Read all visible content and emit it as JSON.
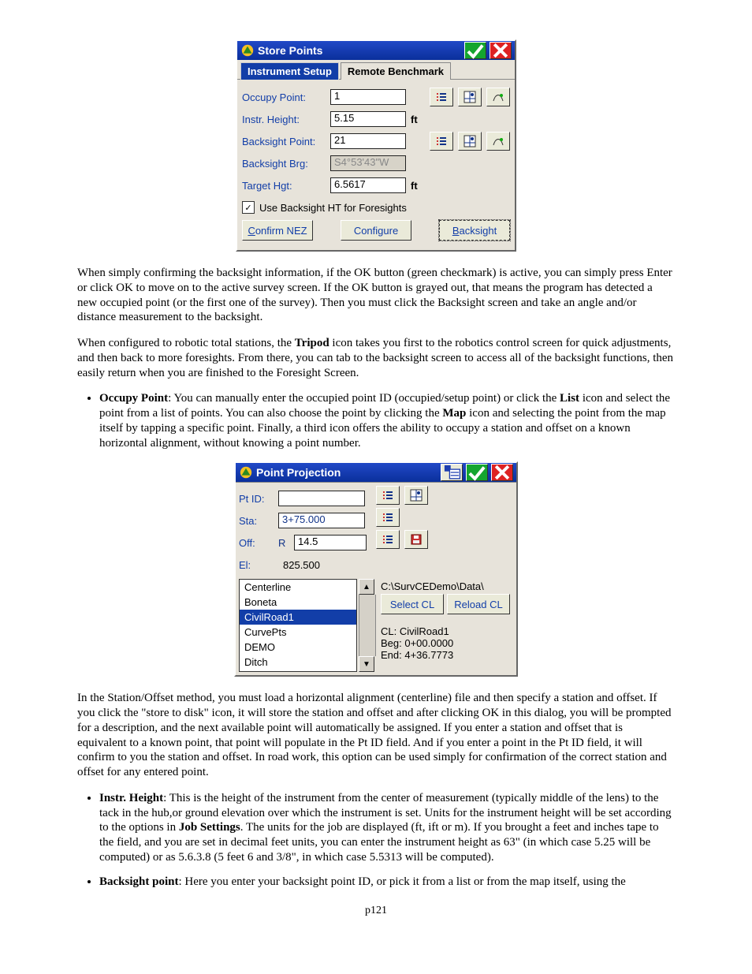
{
  "dlg1": {
    "title": "Store Points",
    "tabs": [
      "Instrument Setup",
      "Remote Benchmark"
    ],
    "active_tab": 0,
    "rows": {
      "occupy_label": "Occupy Point:",
      "occupy_value": "1",
      "instr_label": "Instr. Height:",
      "instr_value": "5.15",
      "instr_unit": "ft",
      "bs_pt_label": "Backsight Point:",
      "bs_pt_value": "21",
      "bs_brg_label": "Backsight Brg:",
      "bs_brg_value": "S4°53'43\"W",
      "tgt_label": "Target Hgt:",
      "tgt_value": "6.5617",
      "tgt_unit": "ft",
      "chk_label": "Use Backsight HT for Foresights"
    },
    "buttons": {
      "confirm_u": "C",
      "confirm_rest": "onfirm NEZ",
      "config": "Configure",
      "back_u": "B",
      "back_rest": "acksight"
    }
  },
  "para1": "When simply confirming the backsight information, if the OK button (green checkmark) is active, you can simply press Enter or click OK to move on to the active survey screen.  If the OK button is grayed out, that means the program has detected a new occupied point (or the first one of the survey).  Then you must click the Backsight screen and take an angle and/or distance  measurement to the backsight.",
  "para2_before": "When configured to robotic total stations, the ",
  "para2_bold": "Tripod",
  "para2_after": " icon takes you first to the robotics control screen for quick adjustments, and then back to more foresights. From there, you can tab to the backsight screen to access all of the backsight functions, then easily return when you are finished to the Foresight Screen.",
  "bullet1_bold": "Occupy Point",
  "bullet1_after1": ": You can manually enter the occupied point ID (occupied/setup point) or click the ",
  "bullet1_bold2": "List",
  "bullet1_after2": " icon and select the point from a list of points.  You can also choose the point by clicking the ",
  "bullet1_bold3": "Map",
  "bullet1_after3": " icon and selecting the point from the map itself by tapping a specific point.  Finally, a third icon offers the ability to occupy a station and offset on a known horizontal alignment, without knowing a point number.",
  "dlg2": {
    "title": "Point Projection",
    "pt_label": "Pt ID:",
    "pt_value": "",
    "sta_label": "Sta:",
    "sta_value": "3+75.000",
    "off_label": "Off:",
    "off_side": "R",
    "off_value": "14.5",
    "el_label": "El:",
    "el_value": "825.500",
    "list": [
      "Centerline",
      "Boneta",
      "CivilRoad1",
      "CurvePts",
      "DEMO",
      "Ditch"
    ],
    "list_sel": 2,
    "path": "C:\\SurvCEDemo\\Data\\",
    "select_btn": "Select CL",
    "reload_btn": "Reload CL",
    "cl_line": "CL:   CivilRoad1",
    "beg_line": "Beg: 0+00.0000",
    "end_line": "End: 4+36.7773"
  },
  "para3": "In the Station/Offset method, you must load a horizontal alignment (centerline) file and then specify a station and offset.  If you click the \"store to disk\" icon, it will store the station and offset and after clicking OK in this dialog, you will be prompted for a description, and the next available point will automatically be assigned.  If you enter a station and offset that is equivalent to a known point, that point will populate in the Pt ID field.  And if you enter a point in the Pt ID field, it will confirm to you the station and offset.  In road work, this option can be used simply for confirmation of the correct station and offset for any entered point.",
  "bullet2_bold": "Instr. Height",
  "bullet2_after1": ": This is the height of the instrument from the center of measurement (typically middle of the lens) to the tack in the hub,or ground elevation over which the instrument is set.   Units for the instrument height will be set according to the options in ",
  "bullet2_bold2": "Job Settings",
  "bullet2_after2": ".   The units for the job are displayed (ft, ift or m).    If you brought a feet and inches tape to the field, and you are set in decimal feet units, you can enter the instrument height as 63\" (in which case 5.25 will be computed) or as 5.6.3.8 (5 feet 6 and 3/8\", in which case 5.5313 will be computed).",
  "bullet3_bold": "Backsight point",
  "bullet3_after": ": Here you enter your backsight point ID, or pick it from a list or from the map itself, using the",
  "page": "p121"
}
